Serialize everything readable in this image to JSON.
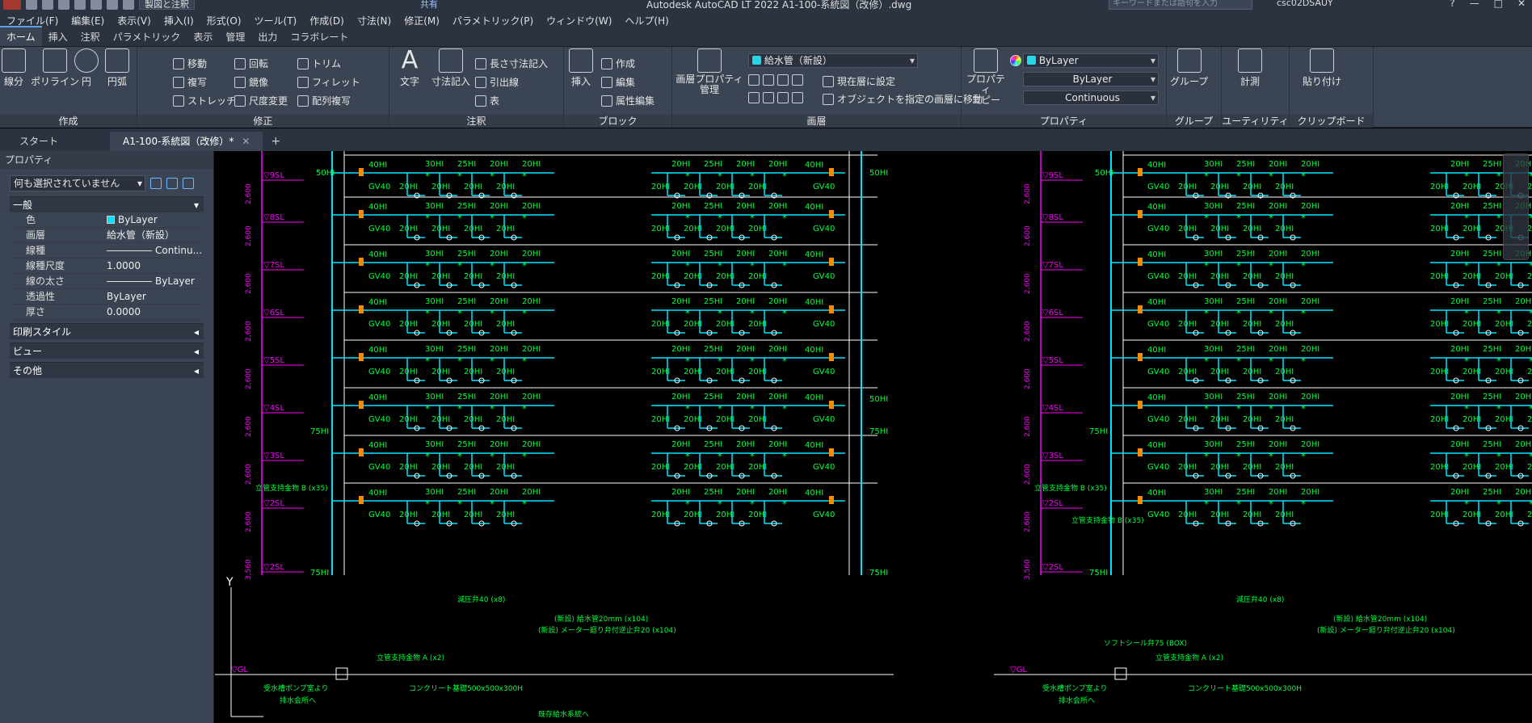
{
  "titlebar": {
    "workspace": "製図と注釈",
    "share": "共有",
    "title": "Autodesk AutoCAD LT 2022    A1-100-系統図（改修）.dwg",
    "search_placeholder": "キーワードまたは語句を入力",
    "user": "csc02DSAUY"
  },
  "menu": [
    "ファイル(F)",
    "編集(E)",
    "表示(V)",
    "挿入(I)",
    "形式(O)",
    "ツール(T)",
    "作成(D)",
    "寸法(N)",
    "修正(M)",
    "パラメトリック(P)",
    "ウィンドウ(W)",
    "ヘルプ(H)"
  ],
  "ribbon_tabs": [
    "ホーム",
    "挿入",
    "注釈",
    "パラメトリック",
    "表示",
    "管理",
    "出力",
    "コラボレート"
  ],
  "ribbon": {
    "draw": {
      "title": "作成",
      "line": "線分",
      "polyline": "ポリライン",
      "circle": "円",
      "arc": "円弧"
    },
    "modify": {
      "title": "修正",
      "move": "移動",
      "rotate": "回転",
      "trim": "トリム",
      "copy": "複写",
      "mirror": "鏡像",
      "fillet": "フィレット",
      "stretch": "ストレッチ",
      "scale": "尺度変更",
      "array": "配列複写"
    },
    "annotation": {
      "title": "注釈",
      "text": "文字",
      "dimension": "寸法記入",
      "linear": "長さ寸法記入",
      "leader": "引出線",
      "table": "表"
    },
    "block": {
      "title": "ブロック",
      "insert": "挿入",
      "create": "作成",
      "edit": "編集",
      "attedit": "属性編集"
    },
    "layers": {
      "title": "画層",
      "properties": "画層プロパティ\n管理",
      "current_layer": "給水管（新設）",
      "set_current": "現在層に設定",
      "match": "オブジェクトを指定の画層に移動"
    },
    "properties": {
      "title": "プロパティ",
      "match": "プロパティ\nコピー",
      "color": "ByLayer",
      "lineweight": "ByLayer",
      "linetype": "Continuous"
    },
    "groups": {
      "title": "グループ",
      "group": "グループ"
    },
    "utilities": {
      "title": "ユーティリティ",
      "measure": "計測"
    },
    "clipboard": {
      "title": "クリップボード",
      "paste": "貼り付け"
    }
  },
  "doc_tabs": {
    "start": "スタート",
    "active": "A1-100-系統図（改修）*"
  },
  "properties_panel": {
    "header": "プロパティ",
    "selection": "何も選択されていません",
    "general": "一般",
    "rows": [
      {
        "k": "色",
        "v": "ByLayer"
      },
      {
        "k": "画層",
        "v": "給水管（新設）"
      },
      {
        "k": "線種",
        "v": "Continu..."
      },
      {
        "k": "線種尺度",
        "v": "1.0000"
      },
      {
        "k": "線の太さ",
        "v": "ByLayer"
      },
      {
        "k": "透過性",
        "v": "ByLayer"
      },
      {
        "k": "厚さ",
        "v": "0.0000"
      }
    ],
    "sections": [
      "印刷スタイル",
      "ビュー",
      "その他"
    ]
  },
  "drawing": {
    "levels": [
      "▽9SL",
      "▽8SL",
      "▽7SL",
      "▽6SL",
      "▽5SL",
      "▽4SL",
      "▽3SL",
      "▽2SL",
      "▽GL"
    ],
    "heights": [
      "2,600",
      "2,600",
      "2,600",
      "2,600",
      "2,600",
      "2,600",
      "2,600",
      "2,600",
      "3,560"
    ],
    "pipe_labels": [
      "40HI",
      "30HI",
      "25HI",
      "20HI",
      "GV40",
      "50HI",
      "75HI"
    ],
    "notes": [
      "立管支持金物 B (x35)",
      "減圧弁40 (x8)",
      "(新設) 給水管20mm (x104)",
      "(新設) メーター廻り弁付逆止弁20 (x104)",
      "立管支持金物 A (x2)",
      "コンクリート基礎500x500x300H",
      "ソフトシール弁75 (BOX)",
      "受水槽ポンプ室より",
      "排水会所へ",
      "既存給水系統へ"
    ],
    "axis": "Y"
  },
  "colors": {
    "pipe": "#00e5ff",
    "text": "#00ff3c",
    "magenta": "#ff00ff",
    "yellow": "#ffff00",
    "orange": "#ff8c00",
    "white": "#ffffff"
  }
}
